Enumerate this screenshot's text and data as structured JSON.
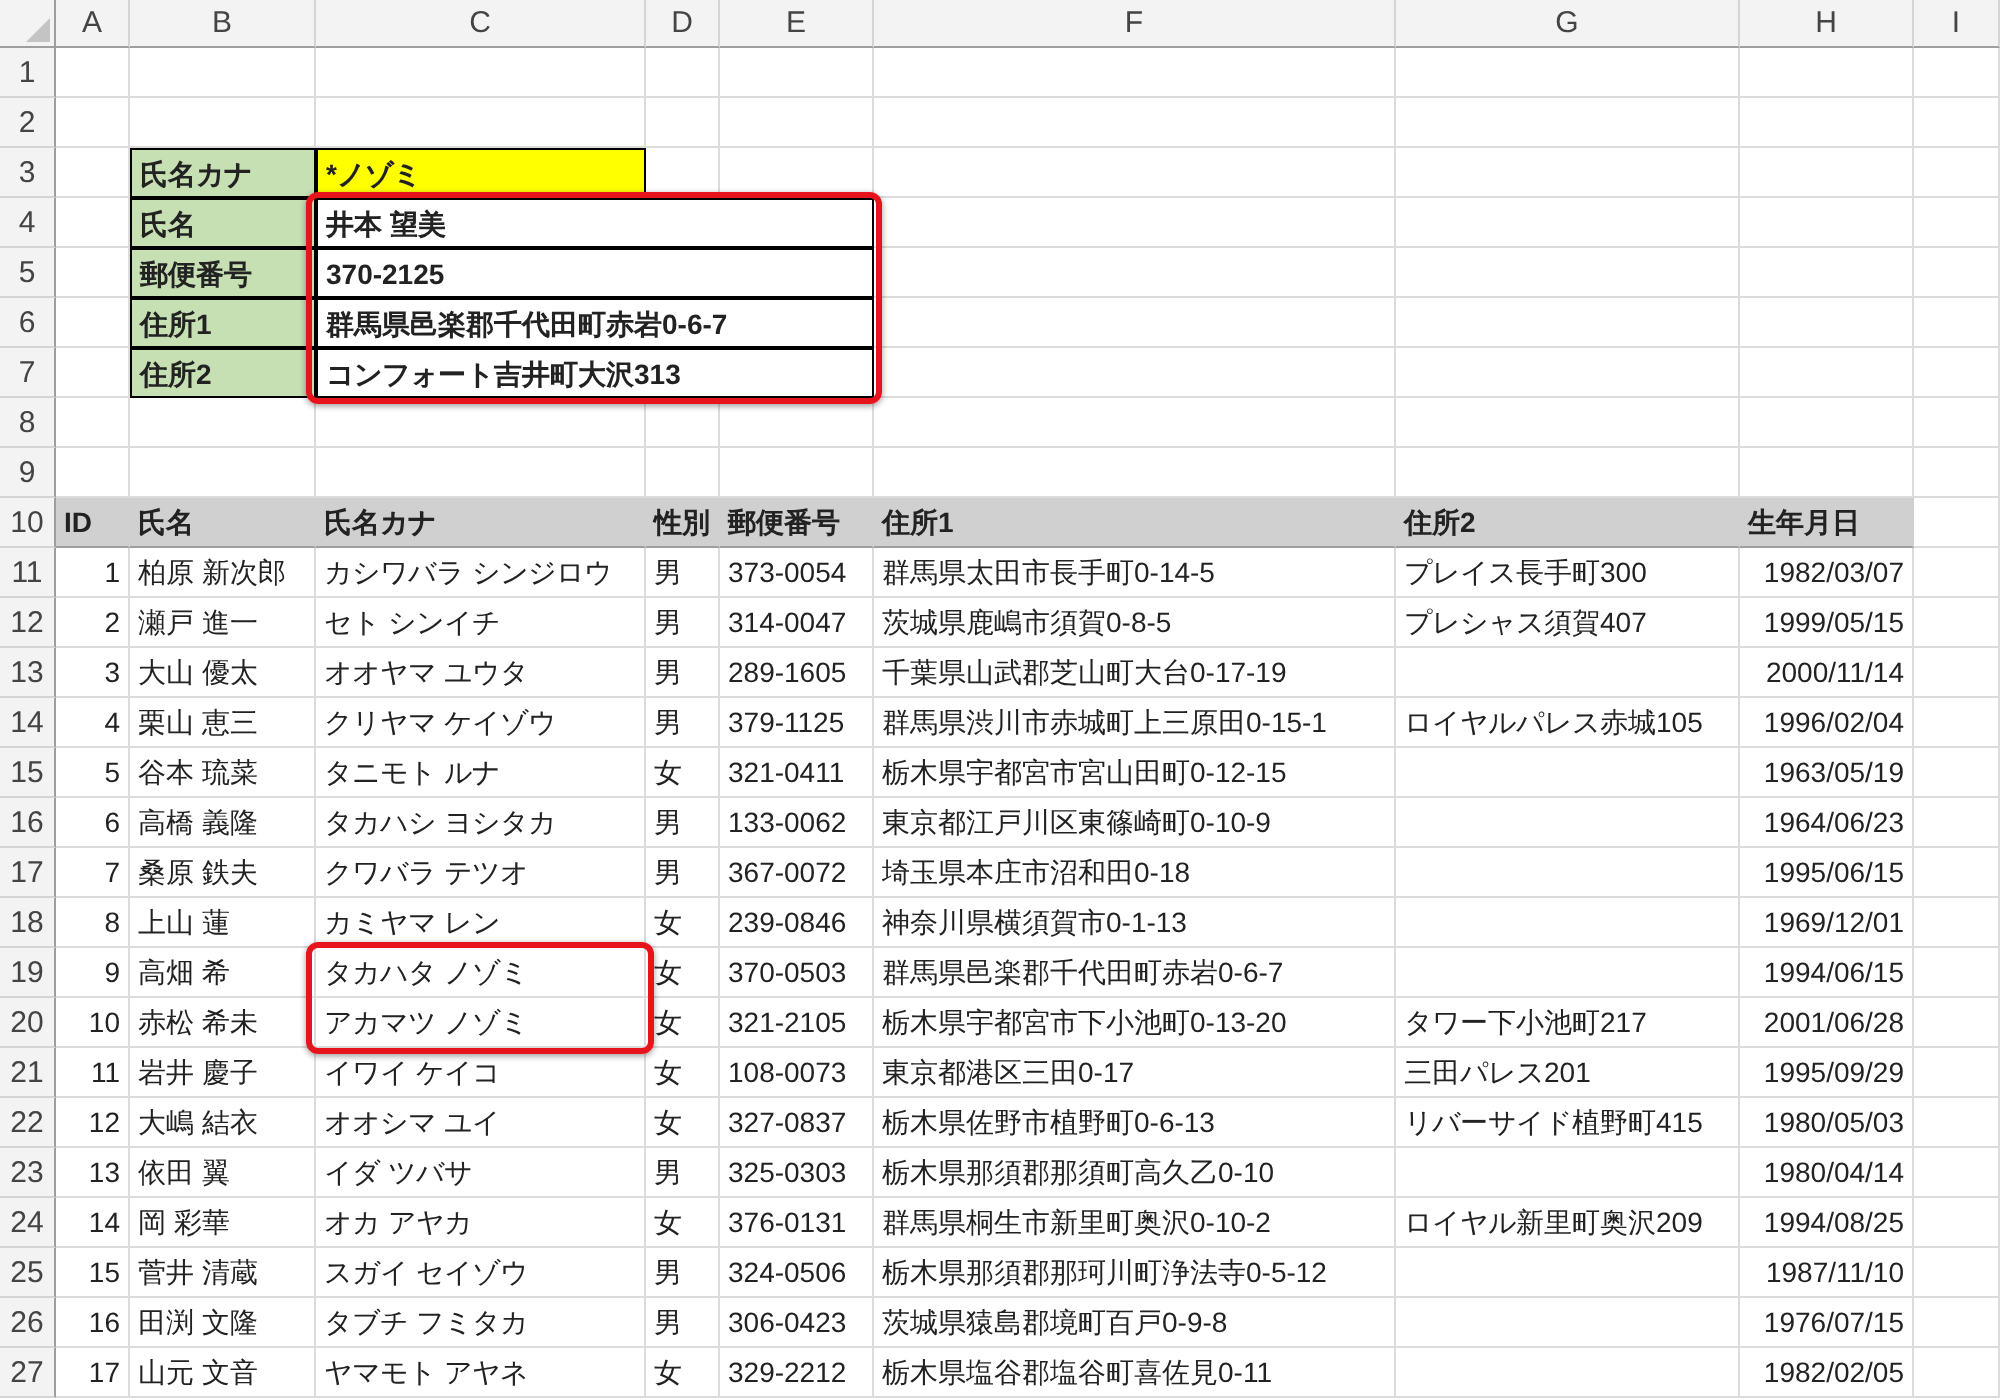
{
  "columns": [
    "A",
    "B",
    "C",
    "D",
    "E",
    "F",
    "G",
    "H",
    "I"
  ],
  "row_numbers": [
    "1",
    "2",
    "3",
    "4",
    "5",
    "6",
    "7",
    "8",
    "9",
    "10",
    "11",
    "12",
    "13",
    "14",
    "15",
    "16",
    "17",
    "18",
    "19",
    "20",
    "21",
    "22",
    "23",
    "24",
    "25",
    "26",
    "27"
  ],
  "lookup_form": {
    "marked": true,
    "fields": [
      {
        "kind": "query",
        "label": "氏名カナ",
        "value": "*ノゾミ"
      },
      {
        "kind": "result",
        "label": "氏名",
        "value": "井本 望美"
      },
      {
        "kind": "result",
        "label": "郵便番号",
        "value": "370-2125"
      },
      {
        "kind": "result",
        "label": "住所1",
        "value": "群馬県邑楽郡千代田町赤岩0-6-7"
      },
      {
        "kind": "result",
        "label": "住所2",
        "value": "コンフォート吉井町大沢313"
      }
    ]
  },
  "table": {
    "columns": [
      "ID",
      "氏名",
      "氏名カナ",
      "性別",
      "郵便番号",
      "住所1",
      "住所2",
      "生年月日"
    ],
    "rows": [
      {
        "marked": false,
        "cells": [
          "1",
          "柏原 新次郎",
          "カシワバラ シンジロウ",
          "男",
          "373-0054",
          "群馬県太田市長手町0-14-5",
          "プレイス長手町300",
          "1982/03/07"
        ]
      },
      {
        "marked": false,
        "cells": [
          "2",
          "瀬戸 進一",
          "セト シンイチ",
          "男",
          "314-0047",
          "茨城県鹿嶋市須賀0-8-5",
          "プレシャス須賀407",
          "1999/05/15"
        ]
      },
      {
        "marked": false,
        "cells": [
          "3",
          "大山 優太",
          "オオヤマ ユウタ",
          "男",
          "289-1605",
          "千葉県山武郡芝山町大台0-17-19",
          null,
          "2000/11/14"
        ]
      },
      {
        "marked": false,
        "cells": [
          "4",
          "栗山 恵三",
          "クリヤマ ケイゾウ",
          "男",
          "379-1125",
          "群馬県渋川市赤城町上三原田0-15-1",
          "ロイヤルパレス赤城105",
          "1996/02/04"
        ]
      },
      {
        "marked": false,
        "cells": [
          "5",
          "谷本 琉菜",
          "タニモト ルナ",
          "女",
          "321-0411",
          "栃木県宇都宮市宮山田町0-12-15",
          null,
          "1963/05/19"
        ]
      },
      {
        "marked": false,
        "cells": [
          "6",
          "高橋 義隆",
          "タカハシ ヨシタカ",
          "男",
          "133-0062",
          "東京都江戸川区東篠崎町0-10-9",
          null,
          "1964/06/23"
        ]
      },
      {
        "marked": false,
        "cells": [
          "7",
          "桑原 鉄夫",
          "クワバラ テツオ",
          "男",
          "367-0072",
          "埼玉県本庄市沼和田0-18",
          null,
          "1995/06/15"
        ]
      },
      {
        "marked": false,
        "cells": [
          "8",
          "上山 蓮",
          "カミヤマ レン",
          "女",
          "239-0846",
          "神奈川県横須賀市0-1-13",
          null,
          "1969/12/01"
        ]
      },
      {
        "marked": true,
        "cells": [
          "9",
          "高畑 希",
          "タカハタ ノゾミ",
          "女",
          "370-0503",
          "群馬県邑楽郡千代田町赤岩0-6-7",
          null,
          "1994/06/15"
        ]
      },
      {
        "marked": true,
        "cells": [
          "10",
          "赤松 希未",
          "アカマツ ノゾミ",
          "女",
          "321-2105",
          "栃木県宇都宮市下小池町0-13-20",
          "タワー下小池町217",
          "2001/06/28"
        ]
      },
      {
        "marked": false,
        "cells": [
          "11",
          "岩井 慶子",
          "イワイ ケイコ",
          "女",
          "108-0073",
          "東京都港区三田0-17",
          "三田パレス201",
          "1995/09/29"
        ]
      },
      {
        "marked": false,
        "cells": [
          "12",
          "大嶋 結衣",
          "オオシマ ユイ",
          "女",
          "327-0837",
          "栃木県佐野市植野町0-6-13",
          "リバーサイド植野町415",
          "1980/05/03"
        ]
      },
      {
        "marked": false,
        "cells": [
          "13",
          "依田 翼",
          "イダ ツバサ",
          "男",
          "325-0303",
          "栃木県那須郡那須町高久乙0-10",
          null,
          "1980/04/14"
        ]
      },
      {
        "marked": false,
        "cells": [
          "14",
          "岡 彩華",
          "オカ アヤカ",
          "女",
          "376-0131",
          "群馬県桐生市新里町奥沢0-10-2",
          "ロイヤル新里町奥沢209",
          "1994/08/25"
        ]
      },
      {
        "marked": false,
        "cells": [
          "15",
          "菅井 清蔵",
          "スガイ セイゾウ",
          "男",
          "324-0506",
          "栃木県那須郡那珂川町浄法寺0-5-12",
          null,
          "1987/11/10"
        ]
      },
      {
        "marked": false,
        "cells": [
          "16",
          "田渕 文隆",
          "タブチ フミタカ",
          "男",
          "306-0423",
          "茨城県猿島郡境町百戸0-9-8",
          null,
          "1976/07/15"
        ]
      },
      {
        "marked": false,
        "cells": [
          "17",
          "山元 文音",
          "ヤマモト アヤネ",
          "女",
          "329-2212",
          "栃木県塩谷郡塩谷町喜佐見0-11",
          null,
          "1982/02/05"
        ]
      }
    ]
  }
}
